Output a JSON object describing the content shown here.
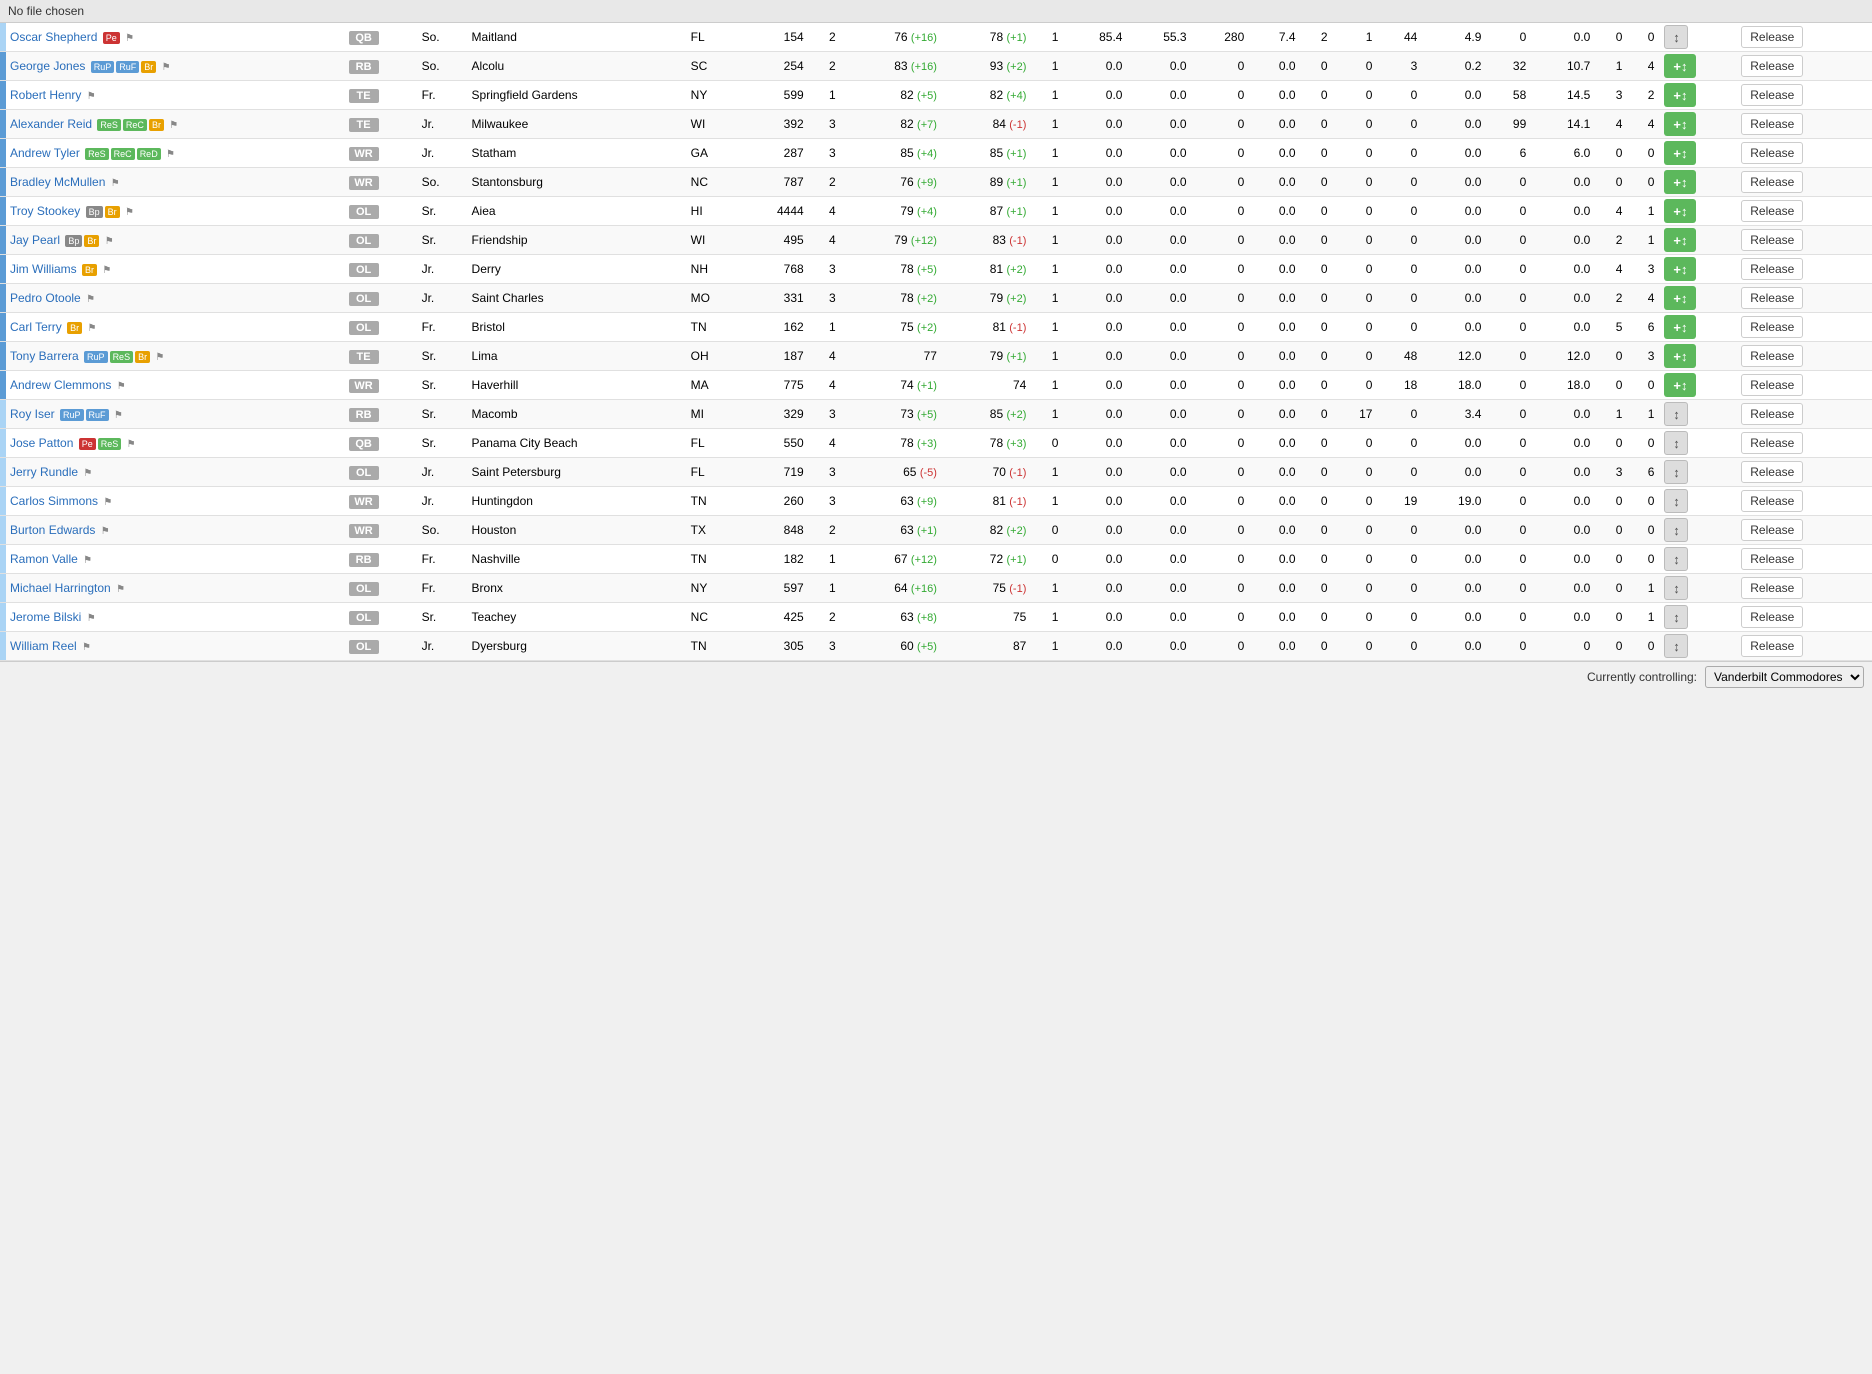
{
  "file_bar": "No file chosen",
  "currently_controlling": "Currently controlling:",
  "team_select": "Vanderbilt Commodores",
  "players": [
    {
      "name": "Oscar Shepherd",
      "tags": [
        "Pe"
      ],
      "flag": true,
      "pos": "QB",
      "yr": "So.",
      "city": "Maitland",
      "state": "FL",
      "rating": 154,
      "stars": 2,
      "ovr": "76",
      "ovr_delta": "+16",
      "pot": "78",
      "pot_delta": "+1",
      "conf": 1,
      "gpa": 85.4,
      "morale": 55.3,
      "snap": 280,
      "snap2": 7.4,
      "v1": 2,
      "v2": 1,
      "v3": 44,
      "v4": 4.9,
      "v5": 0,
      "v6": "0.0",
      "v7": 0,
      "v8": 0,
      "bar_color": "light-blue",
      "btn_type": "gray"
    },
    {
      "name": "George Jones",
      "tags": [
        "RuP",
        "RuF",
        "Br"
      ],
      "flag": true,
      "pos": "RB",
      "yr": "So.",
      "city": "Alcolu",
      "state": "SC",
      "rating": 254,
      "stars": 2,
      "ovr": "83",
      "ovr_delta": "+16",
      "pot": "93",
      "pot_delta": "+2",
      "conf": 1,
      "gpa": 0.0,
      "morale": 0.0,
      "snap": 0,
      "snap2": 0.0,
      "v1": 0,
      "v2": 0,
      "v3": 3,
      "v4": 0.2,
      "v5": 32,
      "v6": "10.7",
      "v7": 1,
      "v8": 4,
      "bar_color": "blue",
      "btn_type": "green"
    },
    {
      "name": "Robert Henry",
      "tags": [],
      "flag": true,
      "pos": "TE",
      "yr": "Fr.",
      "city": "Springfield Gardens",
      "state": "NY",
      "rating": 599,
      "stars": 1,
      "ovr": "82",
      "ovr_delta": "+5",
      "pot": "82",
      "pot_delta": "+4",
      "conf": 1,
      "gpa": 0.0,
      "morale": 0.0,
      "snap": 0,
      "snap2": 0.0,
      "v1": 0,
      "v2": 0,
      "v3": 0,
      "v4": 0.0,
      "v5": 58,
      "v6": "14.5",
      "v7": 3,
      "v8": 2,
      "bar_color": "blue",
      "btn_type": "green"
    },
    {
      "name": "Alexander Reid",
      "tags": [
        "ReS",
        "ReC",
        "Br"
      ],
      "flag": true,
      "pos": "TE",
      "yr": "Jr.",
      "city": "Milwaukee",
      "state": "WI",
      "rating": 392,
      "stars": 3,
      "ovr": "82",
      "ovr_delta": "+7",
      "pot": "84",
      "pot_delta": "-1",
      "conf": 1,
      "gpa": 0.0,
      "morale": 0.0,
      "snap": 0,
      "snap2": 0.0,
      "v1": 0,
      "v2": 0,
      "v3": 0,
      "v4": 0.0,
      "v5": 99,
      "v6": "14.1",
      "v7": 4,
      "v8": 4,
      "bar_color": "blue",
      "btn_type": "green"
    },
    {
      "name": "Andrew Tyler",
      "tags": [
        "ReS",
        "ReC",
        "ReD"
      ],
      "flag": true,
      "pos": "WR",
      "yr": "Jr.",
      "city": "Statham",
      "state": "GA",
      "rating": 287,
      "stars": 3,
      "ovr": "85",
      "ovr_delta": "+4",
      "pot": "85",
      "pot_delta": "+1",
      "conf": 1,
      "gpa": 0.0,
      "morale": 0.0,
      "snap": 0,
      "snap2": 0.0,
      "v1": 0,
      "v2": 0,
      "v3": 0,
      "v4": 0.0,
      "v5": 6,
      "v6": "6.0",
      "v7": 0,
      "v8": 0,
      "bar_color": "blue",
      "btn_type": "green"
    },
    {
      "name": "Bradley McMullen",
      "tags": [],
      "flag": true,
      "pos": "WR",
      "yr": "So.",
      "city": "Stantonsburg",
      "state": "NC",
      "rating": 787,
      "stars": 2,
      "ovr": "76",
      "ovr_delta": "+9",
      "pot": "89",
      "pot_delta": "+1",
      "conf": 1,
      "gpa": 0.0,
      "morale": 0.0,
      "snap": 0,
      "snap2": 0.0,
      "v1": 0,
      "v2": 0,
      "v3": 0,
      "v4": 0.0,
      "v5": 0,
      "v6": "0.0",
      "v7": 0,
      "v8": 0,
      "bar_color": "blue",
      "btn_type": "green"
    },
    {
      "name": "Troy Stookey",
      "tags": [
        "Bp",
        "Br"
      ],
      "flag": true,
      "pos": "OL",
      "yr": "Sr.",
      "city": "Aiea",
      "state": "HI",
      "rating": 4444,
      "stars": 4,
      "ovr": "79",
      "ovr_delta": "+4",
      "pot": "87",
      "pot_delta": "+1",
      "conf": 1,
      "gpa": 0.0,
      "morale": 0.0,
      "snap": 0,
      "snap2": 0.0,
      "v1": 0,
      "v2": 0,
      "v3": 0,
      "v4": 0.0,
      "v5": 0,
      "v6": "0.0",
      "v7": 4,
      "v8": 1,
      "bar_color": "blue",
      "btn_type": "green"
    },
    {
      "name": "Jay Pearl",
      "tags": [
        "Bp",
        "Br"
      ],
      "flag": true,
      "pos": "OL",
      "yr": "Sr.",
      "city": "Friendship",
      "state": "WI",
      "rating": 495,
      "stars": 4,
      "ovr": "79",
      "ovr_delta": "+12",
      "pot": "83",
      "pot_delta": "-1",
      "conf": 1,
      "gpa": 0.0,
      "morale": 0.0,
      "snap": 0,
      "snap2": 0.0,
      "v1": 0,
      "v2": 0,
      "v3": 0,
      "v4": 0.0,
      "v5": 0,
      "v6": "0.0",
      "v7": 2,
      "v8": 1,
      "bar_color": "blue",
      "btn_type": "green"
    },
    {
      "name": "Jim Williams",
      "tags": [
        "Br"
      ],
      "flag": true,
      "pos": "OL",
      "yr": "Jr.",
      "city": "Derry",
      "state": "NH",
      "rating": 768,
      "stars": 3,
      "ovr": "78",
      "ovr_delta": "+5",
      "pot": "81",
      "pot_delta": "+2",
      "conf": 1,
      "gpa": 0.0,
      "morale": 0.0,
      "snap": 0,
      "snap2": 0.0,
      "v1": 0,
      "v2": 0,
      "v3": 0,
      "v4": 0.0,
      "v5": 0,
      "v6": "0.0",
      "v7": 4,
      "v8": 3,
      "bar_color": "blue",
      "btn_type": "green"
    },
    {
      "name": "Pedro Otoole",
      "tags": [],
      "flag": true,
      "pos": "OL",
      "yr": "Jr.",
      "city": "Saint Charles",
      "state": "MO",
      "rating": 331,
      "stars": 3,
      "ovr": "78",
      "ovr_delta": "+2",
      "pot": "79",
      "pot_delta": "+2",
      "conf": 1,
      "gpa": 0.0,
      "morale": 0.0,
      "snap": 0,
      "snap2": 0.0,
      "v1": 0,
      "v2": 0,
      "v3": 0,
      "v4": 0.0,
      "v5": 0,
      "v6": "0.0",
      "v7": 2,
      "v8": 4,
      "bar_color": "blue",
      "btn_type": "green"
    },
    {
      "name": "Carl Terry",
      "tags": [
        "Br"
      ],
      "flag": true,
      "pos": "OL",
      "yr": "Fr.",
      "city": "Bristol",
      "state": "TN",
      "rating": 162,
      "stars": 1,
      "ovr": "75",
      "ovr_delta": "+2",
      "pot": "81",
      "pot_delta": "-1",
      "conf": 1,
      "gpa": 0.0,
      "morale": 0.0,
      "snap": 0,
      "snap2": 0.0,
      "v1": 0,
      "v2": 0,
      "v3": 0,
      "v4": 0.0,
      "v5": 0,
      "v6": "0.0",
      "v7": 5,
      "v8": 6,
      "bar_color": "blue",
      "btn_type": "green"
    },
    {
      "name": "Tony Barrera",
      "tags": [
        "RuP",
        "ReS",
        "Br"
      ],
      "flag": true,
      "pos": "TE",
      "yr": "Sr.",
      "city": "Lima",
      "state": "OH",
      "rating": 187,
      "stars": 4,
      "ovr": "77",
      "ovr_delta": "",
      "pot": "79",
      "pot_delta": "+1",
      "conf": 1,
      "gpa": 0.0,
      "morale": 0.0,
      "snap": 0,
      "snap2": 0.0,
      "v1": 0,
      "v2": 0,
      "v3": 48,
      "v4": 12.0,
      "v5": 0,
      "v6": "12.0",
      "v7": 0,
      "v8": 3,
      "bar_color": "blue",
      "btn_type": "green"
    },
    {
      "name": "Andrew Clemmons",
      "tags": [],
      "flag": true,
      "pos": "WR",
      "yr": "Sr.",
      "city": "Haverhill",
      "state": "MA",
      "rating": 775,
      "stars": 4,
      "ovr": "74",
      "ovr_delta": "+1",
      "pot": "74",
      "pot_delta": "",
      "conf": 1,
      "gpa": 0.0,
      "morale": 0.0,
      "snap": 0,
      "snap2": 0.0,
      "v1": 0,
      "v2": 0,
      "v3": 18,
      "v4": 18.0,
      "v5": 0,
      "v6": "18.0",
      "v7": 0,
      "v8": 0,
      "bar_color": "blue",
      "btn_type": "green"
    },
    {
      "name": "Roy Iser",
      "tags": [
        "RuP",
        "RuF"
      ],
      "flag": true,
      "pos": "RB",
      "yr": "Sr.",
      "city": "Macomb",
      "state": "MI",
      "rating": 329,
      "stars": 3,
      "ovr": "73",
      "ovr_delta": "+5",
      "pot": "85",
      "pot_delta": "+2",
      "conf": 1,
      "gpa": 0.0,
      "morale": 0.0,
      "snap": 0,
      "snap2": 0.0,
      "v1": 0,
      "v2": 17,
      "v3": 0,
      "v4": 3.4,
      "v5": 0,
      "v6": "0.0",
      "v7": 1,
      "v8": 1,
      "bar_color": "light-blue",
      "btn_type": "gray"
    },
    {
      "name": "Jose Patton",
      "tags": [
        "Pe",
        "ReS"
      ],
      "flag": true,
      "pos": "QB",
      "yr": "Sr.",
      "city": "Panama City Beach",
      "state": "FL",
      "rating": 550,
      "stars": 4,
      "ovr": "78",
      "ovr_delta": "+3",
      "pot": "78",
      "pot_delta": "+3",
      "conf": 0,
      "gpa": 0.0,
      "morale": 0.0,
      "snap": 0,
      "snap2": 0.0,
      "v1": 0,
      "v2": 0,
      "v3": 0,
      "v4": 0.0,
      "v5": 0,
      "v6": "0.0",
      "v7": 0,
      "v8": 0,
      "bar_color": "light-blue",
      "btn_type": "gray"
    },
    {
      "name": "Jerry Rundle",
      "tags": [],
      "flag": true,
      "pos": "OL",
      "yr": "Jr.",
      "city": "Saint Petersburg",
      "state": "FL",
      "rating": 719,
      "stars": 3,
      "ovr": "65",
      "ovr_delta": "-5",
      "pot": "70",
      "pot_delta": "-1",
      "conf": 1,
      "gpa": 0.0,
      "morale": 0.0,
      "snap": 0,
      "snap2": 0.0,
      "v1": 0,
      "v2": 0,
      "v3": 0,
      "v4": 0.0,
      "v5": 0,
      "v6": "0.0",
      "v7": 3,
      "v8": 6,
      "bar_color": "light-blue",
      "btn_type": "gray"
    },
    {
      "name": "Carlos Simmons",
      "tags": [],
      "flag": true,
      "pos": "WR",
      "yr": "Jr.",
      "city": "Huntingdon",
      "state": "TN",
      "rating": 260,
      "stars": 3,
      "ovr": "63",
      "ovr_delta": "+9",
      "pot": "81",
      "pot_delta": "-1",
      "conf": 1,
      "gpa": 0.0,
      "morale": 0.0,
      "snap": 0,
      "snap2": 0.0,
      "v1": 0,
      "v2": 0,
      "v3": 19,
      "v4": 19.0,
      "v5": 0,
      "v6": "0.0",
      "v7": 0,
      "v8": 0,
      "bar_color": "light-blue",
      "btn_type": "gray"
    },
    {
      "name": "Burton Edwards",
      "tags": [],
      "flag": true,
      "pos": "WR",
      "yr": "So.",
      "city": "Houston",
      "state": "TX",
      "rating": 848,
      "stars": 2,
      "ovr": "63",
      "ovr_delta": "+1",
      "pot": "82",
      "pot_delta": "+2",
      "conf": 0,
      "gpa": 0.0,
      "morale": 0.0,
      "snap": 0,
      "snap2": 0.0,
      "v1": 0,
      "v2": 0,
      "v3": 0,
      "v4": 0.0,
      "v5": 0,
      "v6": "0.0",
      "v7": 0,
      "v8": 0,
      "bar_color": "light-blue",
      "btn_type": "gray"
    },
    {
      "name": "Ramon Valle",
      "tags": [],
      "flag": true,
      "pos": "RB",
      "yr": "Fr.",
      "city": "Nashville",
      "state": "TN",
      "rating": 182,
      "stars": 1,
      "ovr": "67",
      "ovr_delta": "+12",
      "pot": "72",
      "pot_delta": "+1",
      "conf": 0,
      "gpa": 0.0,
      "morale": 0.0,
      "snap": 0,
      "snap2": 0.0,
      "v1": 0,
      "v2": 0,
      "v3": 0,
      "v4": 0.0,
      "v5": 0,
      "v6": "0.0",
      "v7": 0,
      "v8": 0,
      "bar_color": "light-blue",
      "btn_type": "gray"
    },
    {
      "name": "Michael Harrington",
      "tags": [],
      "flag": true,
      "pos": "OL",
      "yr": "Fr.",
      "city": "Bronx",
      "state": "NY",
      "rating": 597,
      "stars": 1,
      "ovr": "64",
      "ovr_delta": "+16",
      "pot": "75",
      "pot_delta": "-1",
      "conf": 1,
      "gpa": 0.0,
      "morale": 0.0,
      "snap": 0,
      "snap2": 0.0,
      "v1": 0,
      "v2": 0,
      "v3": 0,
      "v4": 0.0,
      "v5": 0,
      "v6": "0.0",
      "v7": 0,
      "v8": 1,
      "bar_color": "light-blue",
      "btn_type": "gray"
    },
    {
      "name": "Jerome Bilski",
      "tags": [],
      "flag": true,
      "pos": "OL",
      "yr": "Sr.",
      "city": "Teachey",
      "state": "NC",
      "rating": 425,
      "stars": 2,
      "ovr": "63",
      "ovr_delta": "+8",
      "pot": "75",
      "pot_delta": "",
      "conf": 1,
      "gpa": 0.0,
      "morale": 0.0,
      "snap": 0,
      "snap2": 0.0,
      "v1": 0,
      "v2": 0,
      "v3": 0,
      "v4": 0.0,
      "v5": 0,
      "v6": "0.0",
      "v7": 0,
      "v8": 1,
      "bar_color": "light-blue",
      "btn_type": "gray"
    },
    {
      "name": "William Reel",
      "tags": [],
      "flag": true,
      "pos": "OL",
      "yr": "Jr.",
      "city": "Dyersburg",
      "state": "TN",
      "rating": 305,
      "stars": 3,
      "ovr": "60",
      "ovr_delta": "+5",
      "pot": "87",
      "pot_delta": "",
      "conf": 1,
      "gpa": 0.0,
      "morale": 0.0,
      "snap": 0,
      "snap2": 0.0,
      "v1": 0,
      "v2": 0,
      "v3": 0,
      "v4": 0.0,
      "v5": 0,
      "v6": "0",
      "v7": 0,
      "v8": 0,
      "bar_color": "light-blue",
      "btn_type": "gray"
    }
  ]
}
